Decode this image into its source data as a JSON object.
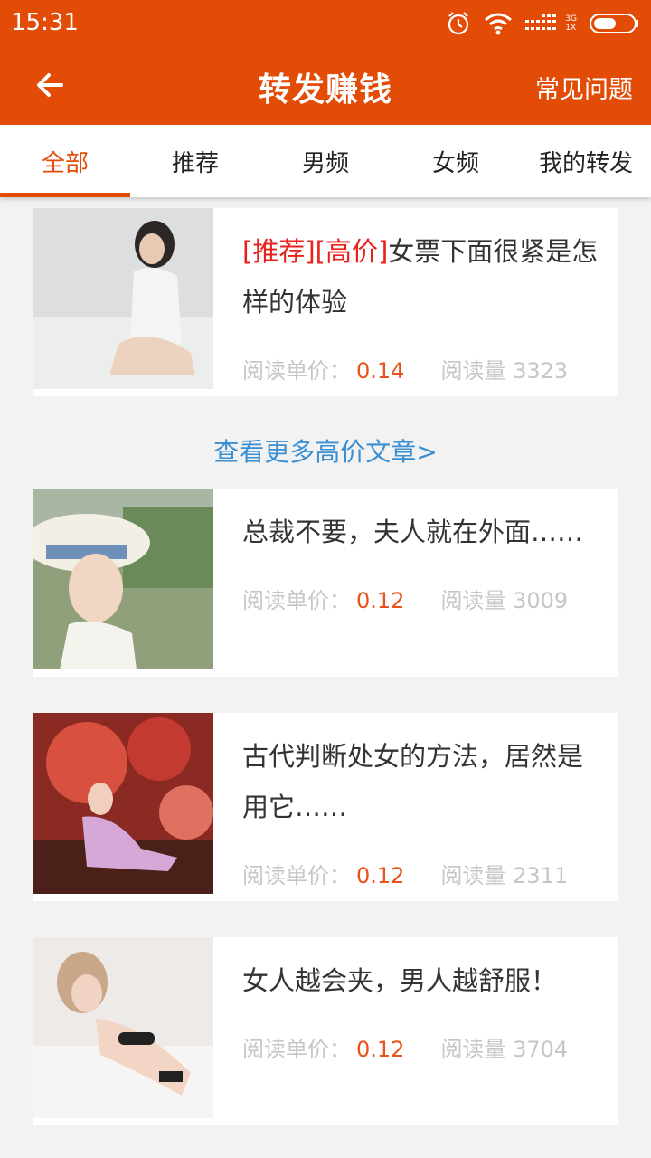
{
  "status_bar": {
    "time": "15:31",
    "network_top": "3G",
    "network_bottom": "1X"
  },
  "header": {
    "title": "转发赚钱",
    "faq": "常见问题"
  },
  "tabs": [
    "全部",
    "推荐",
    "男频",
    "女频",
    "我的转发"
  ],
  "articles": [
    {
      "tags": "[推荐][高价]",
      "title": "女票下面很紧是怎样的体验",
      "price_label": "阅读单价：",
      "price": "0.14",
      "reads_label": "阅读量",
      "reads": "3323"
    },
    {
      "tags": "",
      "title": "总裁不要，夫人就在外面……",
      "price_label": "阅读单价：",
      "price": "0.12",
      "reads_label": "阅读量",
      "reads": "3009"
    },
    {
      "tags": "",
      "title": "古代判断处女的方法，居然是用它……",
      "price_label": "阅读单价：",
      "price": "0.12",
      "reads_label": "阅读量",
      "reads": "2311"
    },
    {
      "tags": "",
      "title": "女人越会夹，男人越舒服！",
      "price_label": "阅读单价：",
      "price": "0.12",
      "reads_label": "阅读量",
      "reads": "3704"
    }
  ],
  "more_link": "查看更多高价文章>",
  "colors": {
    "brand": "#e24c07",
    "tag_red": "#e8211b",
    "price_orange": "#e8531b",
    "link_blue": "#3a8fd1"
  }
}
